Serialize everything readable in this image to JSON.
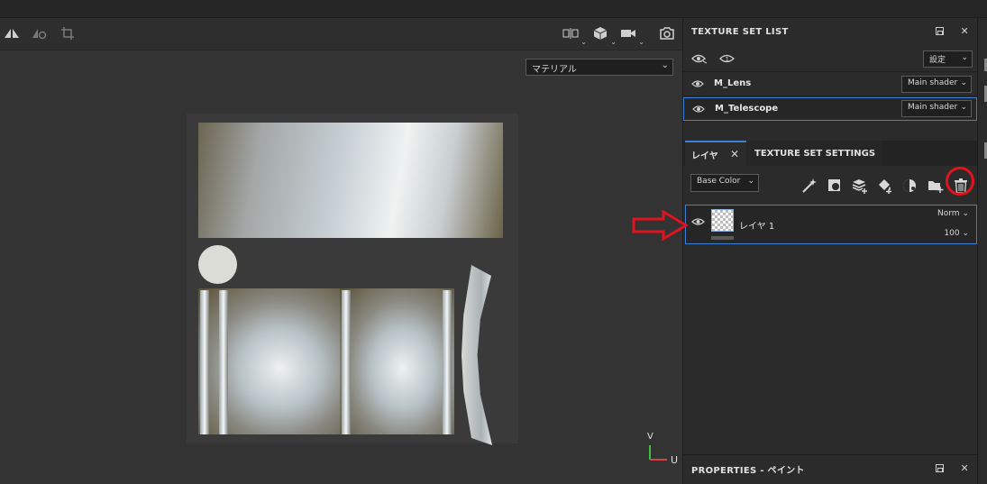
{
  "viewport": {
    "material_select": "マテリアル",
    "axis": {
      "y": "V",
      "x": "U"
    }
  },
  "texture_set_list": {
    "title": "TEXTURE SET LIST",
    "settings_label": "設定",
    "items": [
      {
        "name": "M_Lens",
        "shader": "Main shader",
        "selected": false
      },
      {
        "name": "M_Telescope",
        "shader": "Main shader",
        "selected": true
      }
    ]
  },
  "layers_panel": {
    "tabs": [
      {
        "label": "レイヤ",
        "active": true
      },
      {
        "label": "TEXTURE SET SETTINGS",
        "active": false
      }
    ],
    "channel": "Base Color",
    "layers": [
      {
        "name": "レイヤ 1",
        "blend": "Norm",
        "opacity": "100"
      }
    ]
  },
  "properties": {
    "title": "PROPERTIES - ペイント"
  },
  "colors": {
    "accent": "#3d7fd6",
    "highlight": "#e0141e"
  }
}
